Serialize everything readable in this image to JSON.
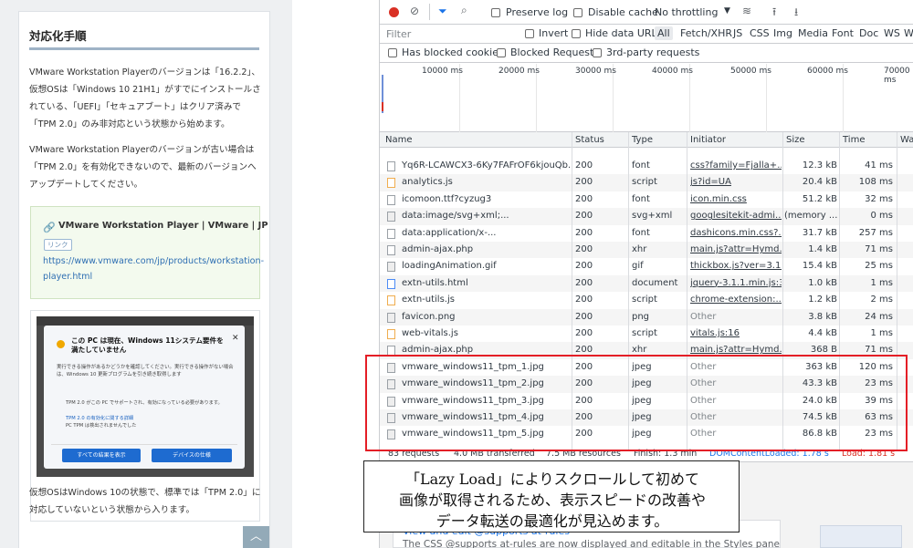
{
  "blog": {
    "heading": "対応化手順",
    "para1": "VMware Workstation Playerのバージョンは「16.2.2」、仮想OSは「Windows 10 21H1」がすでにインストールされている、「UEFI」「セキュアブート」はクリア済みで「TPM 2.0」のみ非対応という状態から始めます。",
    "para2": "VMware Workstation Playerのバージョンが古い場合は「TPM 2.0」を有効化できないので、最新のバージョンへアップデートしてください。",
    "link_title": "VMware Workstation Player | VMware | JP",
    "link_badge": "リンク",
    "link_url": "https://www.vmware.com/jp/products/workstation-player.html",
    "dialog": {
      "title": "この PC は現在、Windows 11システム要件を満たしていません",
      "body": "実行できる操作があるかどうかを確認してください。実行できる操作がない場合は、Windows 10 更新プログラムを引き続き取得します",
      "note": "TPM 2.0 がこの PC でサポートされ、有効になっている必要があります。",
      "note_link": "TPM 2.0 の有効化に関する詳細",
      "note2": "PC TPM は検出されませんでした",
      "btn1": "すべての結果を表示",
      "btn2": "デバイスの仕様"
    },
    "para3": "仮想OSはWindows 10の状態で、標準では「TPM 2.0」に対応していないという状態から入ります。"
  },
  "devtools": {
    "toolbar": {
      "preserve_log": "Preserve log",
      "disable_cache": "Disable cache",
      "throttling": "No throttling"
    },
    "filter": {
      "placeholder": "Filter",
      "invert": "Invert",
      "hide_data_urls": "Hide data URLs",
      "types": [
        "All",
        "Fetch/XHR",
        "JS",
        "CSS",
        "Img",
        "Media",
        "Font",
        "Doc",
        "WS",
        "Wa"
      ]
    },
    "filter2": {
      "blocked_cookies": "Has blocked cookies",
      "blocked_requests": "Blocked Requests",
      "third_party": "3rd-party requests"
    },
    "ticks": [
      "10000 ms",
      "20000 ms",
      "30000 ms",
      "40000 ms",
      "50000 ms",
      "60000 ms",
      "70000 ms"
    ],
    "columns": {
      "name": "Name",
      "status": "Status",
      "type": "Type",
      "initiator": "Initiator",
      "size": "Size",
      "time": "Time",
      "waterfall": "Wa"
    },
    "rows": [
      {
        "name": "Yq6R-LCAWCX3-6Ky7FAFrOF6kjouQb...",
        "status": "200",
        "type": "font",
        "initiator": "css?family=Fjalla+...",
        "size": "12.3 kB",
        "time": "41 ms",
        "icon": "file-icon",
        "init_link": true
      },
      {
        "name": "analytics.js",
        "status": "200",
        "type": "script",
        "initiator": "js?id=UA",
        "size": "20.4 kB",
        "time": "108 ms",
        "icon": "script-icon",
        "init_link": true
      },
      {
        "name": "icomoon.ttf?cyzug3",
        "status": "200",
        "type": "font",
        "initiator": "icon.min.css",
        "size": "51.2 kB",
        "time": "32 ms",
        "icon": "file-icon",
        "init_link": true
      },
      {
        "name": "data:image/svg+xml;...",
        "status": "200",
        "type": "svg+xml",
        "initiator": "googlesitekit-admi...",
        "size": "(memory ...",
        "time": "0 ms",
        "icon": "image-icon",
        "init_link": true
      },
      {
        "name": "data:application/x-...",
        "status": "200",
        "type": "font",
        "initiator": "dashicons.min.css?...",
        "size": "31.7 kB",
        "time": "257 ms",
        "icon": "file-icon",
        "init_link": true
      },
      {
        "name": "admin-ajax.php",
        "status": "200",
        "type": "xhr",
        "initiator": "main.js?attr=Hymd...",
        "size": "1.4 kB",
        "time": "71 ms",
        "icon": "file-icon",
        "init_link": true
      },
      {
        "name": "loadingAnimation.gif",
        "status": "200",
        "type": "gif",
        "initiator": "thickbox.js?ver=3.1...",
        "size": "15.4 kB",
        "time": "25 ms",
        "icon": "image-icon",
        "init_link": true
      },
      {
        "name": "extn-utils.html",
        "status": "200",
        "type": "document",
        "initiator": "jquery-3.1.1.min.js:3",
        "size": "1.0 kB",
        "time": "1 ms",
        "icon": "document-icon",
        "init_link": true
      },
      {
        "name": "extn-utils.js",
        "status": "200",
        "type": "script",
        "initiator": "chrome-extension:...",
        "size": "1.2 kB",
        "time": "2 ms",
        "icon": "script-icon",
        "init_link": true
      },
      {
        "name": "favicon.png",
        "status": "200",
        "type": "png",
        "initiator": "Other",
        "size": "3.8 kB",
        "time": "24 ms",
        "icon": "image-icon",
        "init_link": false
      },
      {
        "name": "web-vitals.js",
        "status": "200",
        "type": "script",
        "initiator": "vitals.js:16",
        "size": "4.4 kB",
        "time": "1 ms",
        "icon": "script-icon",
        "init_link": true
      },
      {
        "name": "admin-ajax.php",
        "status": "200",
        "type": "xhr",
        "initiator": "main.js?attr=Hymd...",
        "size": "368 B",
        "time": "71 ms",
        "icon": "file-icon",
        "init_link": true
      },
      {
        "name": "vmware_windows11_tpm_1.jpg",
        "status": "200",
        "type": "jpeg",
        "initiator": "Other",
        "size": "363 kB",
        "time": "120 ms",
        "icon": "image-icon",
        "init_link": false
      },
      {
        "name": "vmware_windows11_tpm_2.jpg",
        "status": "200",
        "type": "jpeg",
        "initiator": "Other",
        "size": "43.3 kB",
        "time": "23 ms",
        "icon": "image-icon",
        "init_link": false
      },
      {
        "name": "vmware_windows11_tpm_3.jpg",
        "status": "200",
        "type": "jpeg",
        "initiator": "Other",
        "size": "24.0 kB",
        "time": "39 ms",
        "icon": "image-icon",
        "init_link": false
      },
      {
        "name": "vmware_windows11_tpm_4.jpg",
        "status": "200",
        "type": "jpeg",
        "initiator": "Other",
        "size": "74.5 kB",
        "time": "63 ms",
        "icon": "image-icon",
        "init_link": false
      },
      {
        "name": "vmware_windows11_tpm_5.jpg",
        "status": "200",
        "type": "jpeg",
        "initiator": "Other",
        "size": "86.8 kB",
        "time": "23 ms",
        "icon": "image-icon",
        "init_link": false
      }
    ],
    "summary": {
      "requests": "83 requests",
      "transferred": "4.0 MB transferred",
      "resources": "7.5 MB resources",
      "finish": "Finish: 1.3 min",
      "dom": "DOMContentLoaded: 1.78 s",
      "load": "Load: 1.81 s"
    },
    "whatsnew": {
      "title": "View and edit @supports at-rules",
      "body": "The CSS @supports at-rules are now displayed and editable in the Styles pane"
    }
  },
  "callout": {
    "lines": [
      "「Lazy Load」によりスクロールして初めて",
      "画像が取得されるため、表示スピードの改善や",
      "データ転送の最適化が見込めます。"
    ]
  },
  "colors": {
    "highlight_border": "#e41e26",
    "link_blue": "#1a73e8",
    "record_red": "#d93025"
  }
}
